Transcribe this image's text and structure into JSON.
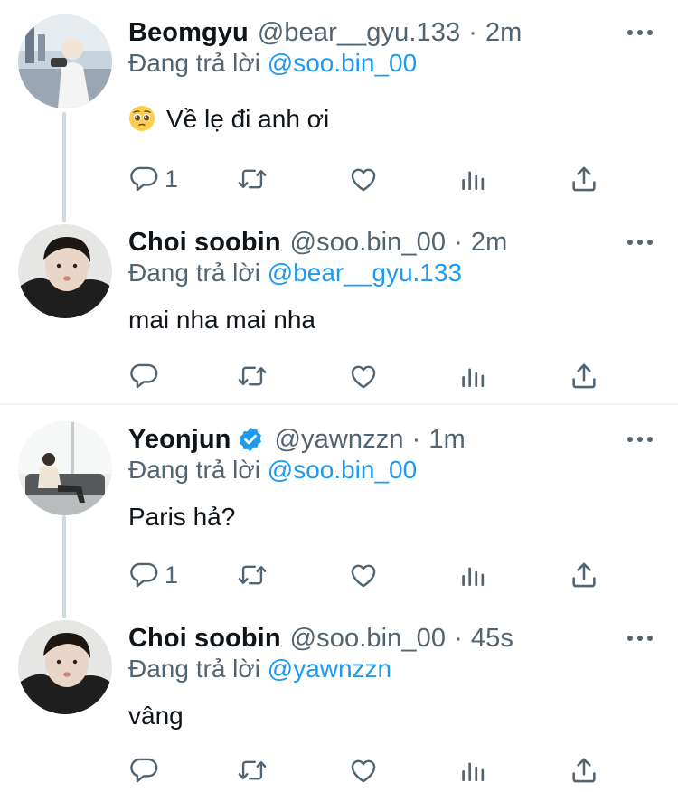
{
  "tweets": [
    {
      "name": "Beomgyu",
      "handle": "@bear__gyu.133",
      "separator": "·",
      "time": "2m",
      "verified": false,
      "replying_prefix": "Đang trả lời",
      "replying_to": "@soo.bin_00",
      "emoji": "pleading-face",
      "text": "Về lẹ đi anh ơi",
      "reply_count": "1"
    },
    {
      "name": "Choi soobin",
      "handle": "@soo.bin_00",
      "separator": "·",
      "time": "2m",
      "verified": false,
      "replying_prefix": "Đang trả lời",
      "replying_to": "@bear__gyu.133",
      "text": "mai nha mai nha",
      "reply_count": ""
    },
    {
      "name": "Yeonjun",
      "handle": "@yawnzzn",
      "separator": "·",
      "time": "1m",
      "verified": true,
      "replying_prefix": "Đang trả lời",
      "replying_to": "@soo.bin_00",
      "text": "Paris hả?",
      "reply_count": "1"
    },
    {
      "name": "Choi soobin",
      "handle": "@soo.bin_00",
      "separator": "·",
      "time": "45s",
      "verified": false,
      "replying_prefix": "Đang trả lời",
      "replying_to": "@yawnzzn",
      "text": "vâng",
      "reply_count": ""
    }
  ],
  "icons": {
    "more": "more-horizontal-icon",
    "reply": "reply-bubble-icon",
    "retweet": "retweet-icon",
    "like": "heart-icon",
    "analytics": "analytics-bars-icon",
    "share": "share-upload-icon",
    "verified": "verified-badge-icon"
  },
  "colors": {
    "text": "#0f1419",
    "muted": "#536471",
    "accent": "#1d9bf0",
    "thread_line": "#cfd9de",
    "divider": "#eff3f4"
  }
}
